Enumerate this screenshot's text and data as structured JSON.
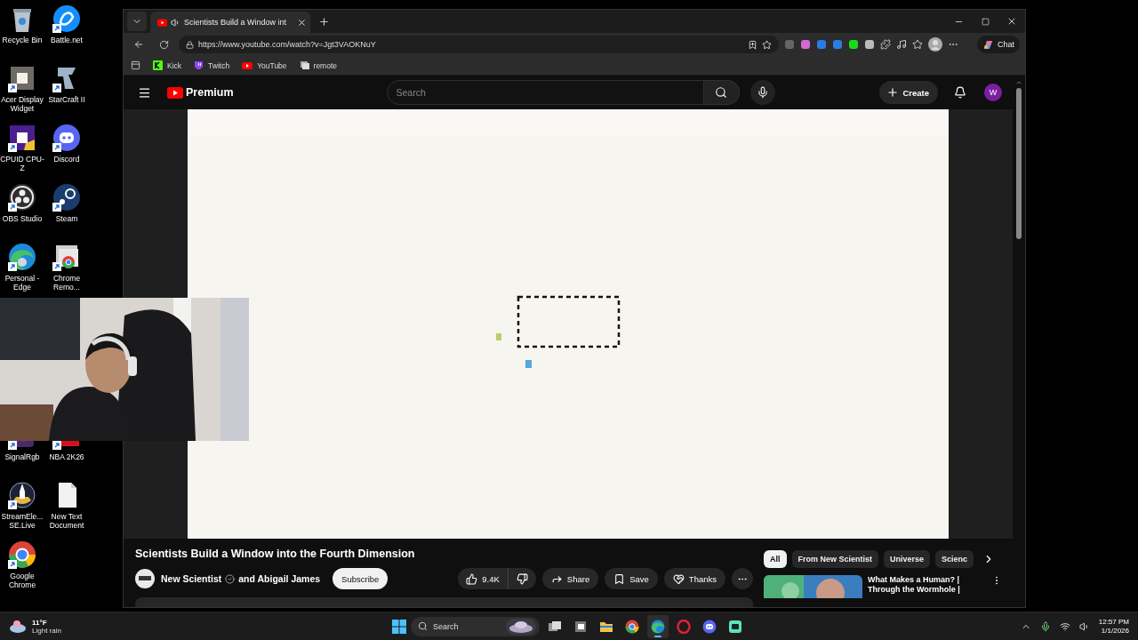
{
  "desktop": {
    "icons_top": [
      {
        "label": "Recycle Bin",
        "kind": "bin"
      },
      {
        "label": "Battle.net",
        "kind": "battlenet"
      },
      {
        "label": "Acer Display Widget",
        "kind": "acer"
      },
      {
        "label": "StarCraft II",
        "kind": "starcraft"
      },
      {
        "label": "CPUID CPU-Z",
        "kind": "cpuz"
      },
      {
        "label": "Discord",
        "kind": "discord"
      },
      {
        "label": "OBS Studio",
        "kind": "obs"
      },
      {
        "label": "Steam",
        "kind": "steam"
      },
      {
        "label": "Personal - Edge",
        "kind": "edge"
      },
      {
        "label": "Chrome Remo...",
        "kind": "chromeremote"
      }
    ],
    "icons_bottom": [
      {
        "label": "SignalRgb",
        "kind": "signalrgb"
      },
      {
        "label": "NBA 2K26",
        "kind": "nba"
      },
      {
        "label": "StreamEle... SE.Live",
        "kind": "streamelements"
      },
      {
        "label": "New Text Document",
        "kind": "textdoc"
      },
      {
        "label": "Google Chrome",
        "kind": "chrome"
      }
    ]
  },
  "browser": {
    "tab": {
      "title": "Scientists Build a Window int",
      "selected": true
    },
    "url": "https://www.youtube.com/watch?v=Jgt3VAOKNuY",
    "copilot": "Chat",
    "bookmarks": [
      {
        "label": "Kick",
        "kind": "kick"
      },
      {
        "label": "Twitch",
        "kind": "twitch"
      },
      {
        "label": "YouTube",
        "kind": "youtube"
      },
      {
        "label": "remote",
        "kind": "remote"
      }
    ]
  },
  "youtube": {
    "logo": "Premium",
    "search_placeholder": "Search",
    "create": "Create",
    "avatar": "W",
    "title": "Scientists Build a Window into the Fourth Dimension",
    "channel": "New Scientist",
    "coauthor": "and Abigail James",
    "subscribe": "Subscribe",
    "likes": "9.4K",
    "actions": [
      {
        "label": "Share",
        "kind": "share"
      },
      {
        "label": "Save",
        "kind": "save"
      },
      {
        "label": "Thanks",
        "kind": "thanks"
      }
    ],
    "chips": [
      {
        "label": "All",
        "selected": true
      },
      {
        "label": "From New Scientist",
        "selected": false
      },
      {
        "label": "Universe",
        "selected": false
      },
      {
        "label": "Scienc",
        "selected": false
      }
    ],
    "recommendation": {
      "lines": [
        "What Makes a Human? |",
        "Through the Wormhole |"
      ]
    }
  },
  "taskbar": {
    "weather": {
      "temp": "11°F",
      "condition": "Light rain"
    },
    "search": "Search",
    "apps": [
      {
        "kind": "taskview",
        "selected": false
      },
      {
        "kind": "widgets",
        "selected": false
      },
      {
        "kind": "files",
        "selected": false
      },
      {
        "kind": "chrome",
        "selected": false
      },
      {
        "kind": "edge",
        "selected": true
      },
      {
        "kind": "opera",
        "selected": false
      },
      {
        "kind": "discord",
        "selected": false
      },
      {
        "kind": "app",
        "selected": false
      }
    ],
    "time": "12:57 PM",
    "date": "1/1/2026"
  }
}
